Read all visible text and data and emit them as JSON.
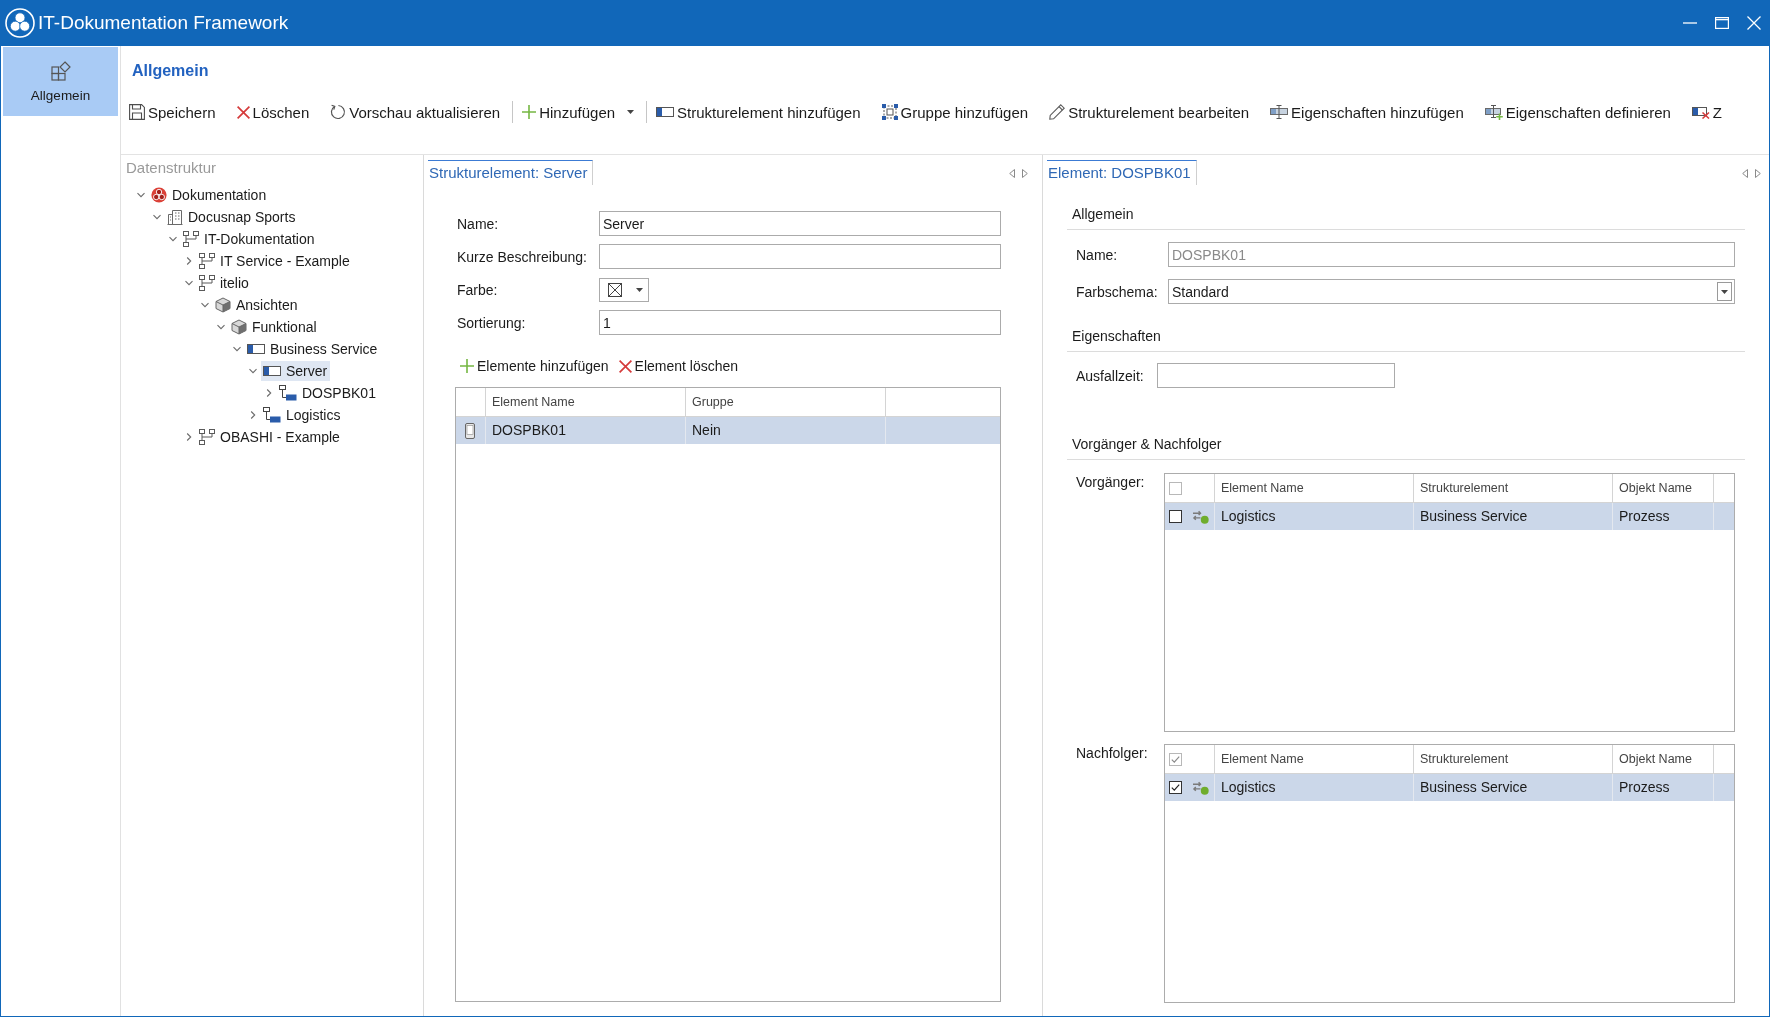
{
  "window": {
    "title": "IT-Dokumentation Framework"
  },
  "nav": [
    {
      "label": "Allgemein",
      "selected": true
    }
  ],
  "page_title": "Allgemein",
  "toolbar": [
    {
      "kind": "save",
      "label": "Speichern"
    },
    {
      "kind": "delete",
      "label": "Löschen"
    },
    {
      "kind": "refresh",
      "label": "Vorschau aktualisieren"
    },
    {
      "kind": "separator"
    },
    {
      "kind": "add",
      "label": "Hinzufügen",
      "dropdown": true
    },
    {
      "kind": "separator"
    },
    {
      "kind": "structure",
      "label": "Strukturelement hinzufügen"
    },
    {
      "kind": "group",
      "label": "Gruppe hinzufügen"
    },
    {
      "kind": "edit",
      "label": "Strukturelement bearbeiten"
    },
    {
      "kind": "properties",
      "label": "Eigenschaften hinzufügen"
    },
    {
      "kind": "define",
      "label": "Eigenschaften definieren"
    },
    {
      "kind": "remove",
      "label": "Z"
    }
  ],
  "tree": {
    "title": "Datenstruktur",
    "items": [
      {
        "label": "Dokumentation",
        "kind": "root",
        "expanded": true,
        "selected": false,
        "children": [
          {
            "label": "Docusnap Sports",
            "kind": "building",
            "expanded": true,
            "selected": false,
            "children": [
              {
                "label": "IT-Dokumentation",
                "kind": "hierarchy",
                "expanded": true,
                "selected": false,
                "children": [
                  {
                    "label": "IT Service - Example",
                    "kind": "hierarchy",
                    "expanded": false,
                    "selected": false
                  },
                  {
                    "label": "itelio",
                    "kind": "hierarchy",
                    "expanded": true,
                    "selected": false,
                    "children": [
                      {
                        "label": "Ansichten",
                        "kind": "view",
                        "expanded": true,
                        "selected": false,
                        "children": [
                          {
                            "label": "Funktional",
                            "kind": "view",
                            "expanded": true,
                            "selected": false,
                            "children": [
                              {
                                "label": "Business Service",
                                "kind": "structure",
                                "expanded": true,
                                "selected": false,
                                "children": [
                                  {
                                    "label": "Server",
                                    "kind": "structure",
                                    "expanded": true,
                                    "selected": true,
                                    "children": [
                                      {
                                        "label": "DOSPBK01",
                                        "kind": "element",
                                        "expanded": false,
                                        "selected": false
                                      }
                                    ]
                                  },
                                  {
                                    "label": "Logistics",
                                    "kind": "element",
                                    "expanded": false,
                                    "selected": false
                                  }
                                ]
                              }
                            ]
                          }
                        ]
                      }
                    ]
                  },
                  {
                    "label": "OBASHI - Example",
                    "kind": "hierarchy",
                    "expanded": false,
                    "selected": false
                  }
                ]
              }
            ]
          }
        ]
      }
    ]
  },
  "structure_panel": {
    "tab": "Strukturelement: Server",
    "fields": [
      {
        "kind": "text",
        "label": "Name:",
        "value": "Server"
      },
      {
        "kind": "text",
        "label": "Kurze Beschreibung:"
      },
      {
        "kind": "color",
        "label": "Farbe:"
      },
      {
        "kind": "text",
        "label": "Sortierung:",
        "value": "1"
      }
    ],
    "actions": [
      {
        "kind": "add",
        "label": "Elemente hinzufügen"
      },
      {
        "kind": "delete",
        "label": "Element löschen"
      }
    ],
    "table": {
      "columns": [
        "Element Name",
        "Gruppe"
      ],
      "rows": [
        {
          "cells": [
            "DOSPBK01",
            "Nein"
          ],
          "selected": true
        }
      ]
    }
  },
  "element_panel": {
    "tab": "Element: DOSPBK01",
    "sections": [
      {
        "title": "Allgemein",
        "fields": [
          {
            "kind": "text",
            "label": "Name:",
            "value": "DOSPBK01",
            "disabled": true
          },
          {
            "kind": "select",
            "label": "Farbschema:",
            "value": "Standard",
            "disabled": false
          }
        ]
      },
      {
        "title": "Eigenschaften",
        "fields": [
          {
            "kind": "short",
            "label": "Ausfallzeit:"
          }
        ]
      },
      {
        "title": "Vorgänger & Nachfolger",
        "grids": [
          {
            "label": "Vorgänger:",
            "all_checked": false,
            "columns": [
              "Element Name",
              "Strukturelement",
              "Objekt Name"
            ],
            "rows": [
              {
                "cells": [
                  "Logistics",
                  "Business Service",
                  "Prozess"
                ],
                "checked": false,
                "selected": true
              }
            ]
          },
          {
            "label": "Nachfolger:",
            "all_checked": true,
            "columns": [
              "Element Name",
              "Strukturelement",
              "Objekt Name"
            ],
            "rows": [
              {
                "cells": [
                  "Logistics",
                  "Business Service",
                  "Prozess"
                ],
                "checked": true,
                "selected": true
              }
            ]
          }
        ]
      }
    ]
  }
}
